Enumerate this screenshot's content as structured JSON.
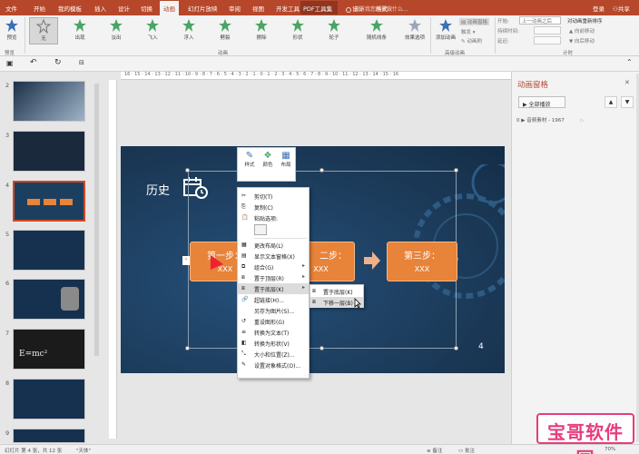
{
  "tabs": [
    "文件",
    "开始",
    "我的模板",
    "插入",
    "设计",
    "切换",
    "动画",
    "幻灯片放映",
    "审阅",
    "视图",
    "开发工具",
    "PDF工具集",
    "设计",
    "格式"
  ],
  "active_tab": "动画",
  "search_placeholder": "告诉我您想要做什么...",
  "account": {
    "login": "登录",
    "share": "共享"
  },
  "ribbon": {
    "preview": "预览",
    "preview_group": "预览",
    "animations": [
      "无",
      "出现",
      "淡出",
      "飞入",
      "浮入",
      "劈裂",
      "擦除",
      "形状",
      "轮子",
      "随机线条"
    ],
    "effect_options": "效果选项",
    "animation_group": "动画",
    "add_animation": "添加动画",
    "animation_pane_btn": "动画窗格",
    "trigger": "触发",
    "animation_painter": "动画刷",
    "advanced_group": "高级动画",
    "start_label": "开始:",
    "start_value": "上一动画之后",
    "duration_label": "持续时间:",
    "delay_label": "延迟:",
    "reorder_title": "对动画重新排序",
    "move_earlier": "向前移动",
    "move_later": "向后移动",
    "timing_group": "计时"
  },
  "ruler_text": "16 · 15 · 14 · 13 · 12 · 11 · 10 · 9 · 8 · 7 · 6 · 5 · 4 · 3 · 2 · 1 · 0 · 1 · 2 · 3 · 4 · 5 · 6 · 7 · 8 · 9 · 10 · 11 · 12 · 13 · 14 · 15 · 16",
  "slides": [
    "2",
    "3",
    "4",
    "5",
    "6",
    "7",
    "8",
    "9"
  ],
  "thumb_text": {
    "emc2": "E=mc²"
  },
  "slide": {
    "title": "历史",
    "box1_title": "第一步：",
    "box1_sub": "XXX",
    "box2_title": "二步：",
    "box2_sub": "XXX",
    "box3_title": "第三步：",
    "box3_sub": "XXX",
    "page_num": "4"
  },
  "mini_toolbar": [
    "样式",
    "颜色",
    "布局"
  ],
  "context_menu": [
    "剪切(T)",
    "复制(C)",
    "粘贴选项:",
    "更改布局(L)",
    "显示文本窗格(X)",
    "组合(G)",
    "置于顶层(R)",
    "置于底层(K)",
    "超链接(H)...",
    "另存为图片(S)...",
    "重设图形(G)",
    "转换为文本(T)",
    "转换为形状(V)",
    "大小和位置(Z)...",
    "设置对象格式(O)..."
  ],
  "submenu": [
    "置于底层(K)",
    "下移一层(B)"
  ],
  "pane": {
    "title": "动画窗格",
    "play_all": "全部播放",
    "item_index": "0",
    "item_label": "音频素材 - 1967"
  },
  "status": {
    "slide_info": "幻灯片 第 4 张，共 12 张",
    "theme": "\"天体\"",
    "notes": "备注",
    "comments": "批注",
    "zoom": "70%"
  },
  "watermark": "宝哥软件园",
  "colors": {
    "accent": "#b7472a",
    "box": "#e8833a",
    "slide_bg": "#1d3f5f"
  }
}
